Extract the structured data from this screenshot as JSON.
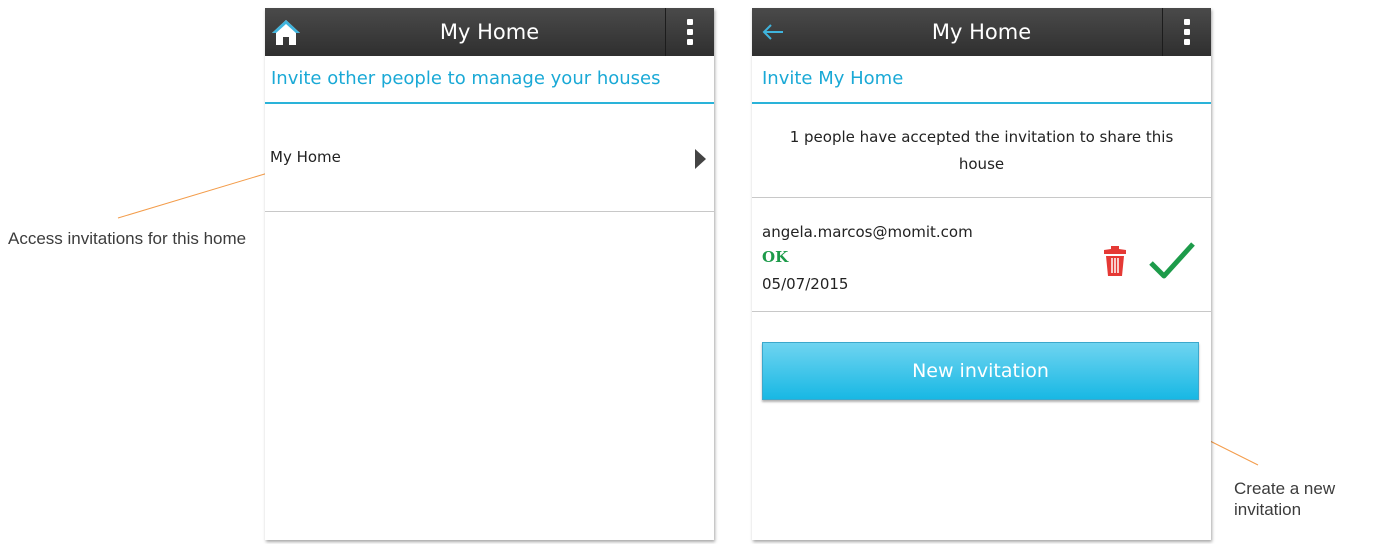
{
  "annotations": {
    "left": "Access invitations for this home",
    "right": "Create a new invitation"
  },
  "screen_left": {
    "appbar": {
      "title": "My Home",
      "left_icon": "home-icon",
      "menu_icon": "overflow-menu-icon"
    },
    "subheader": "Invite other people to manage your houses",
    "list": [
      {
        "label": "My Home",
        "icon": "chevron-right-icon"
      }
    ]
  },
  "screen_right": {
    "appbar": {
      "title": "My Home",
      "left_icon": "back-arrow-icon",
      "menu_icon": "overflow-menu-icon"
    },
    "subheader": "Invite My Home",
    "accepted_text": "1 people have accepted the invitation to share this house",
    "invitation": {
      "email": "angela.marcos@momit.com",
      "status": "OK",
      "date": "05/07/2015",
      "delete_icon": "trash-icon",
      "status_icon": "checkmark-icon"
    },
    "new_invitation_label": "New invitation"
  },
  "colors": {
    "accent": "#1aa9d6",
    "appbar": "#3a3a3a",
    "status_ok": "#1d9b4a",
    "delete": "#e53935",
    "leader_line": "#f39c4a"
  }
}
